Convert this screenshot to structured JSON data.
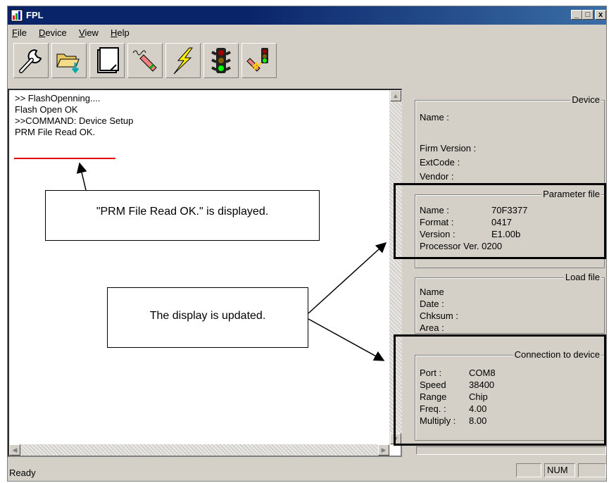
{
  "window": {
    "title": "FPL"
  },
  "menu": [
    {
      "label": "File",
      "accel": "F",
      "rest": "ile"
    },
    {
      "label": "Device",
      "accel": "D",
      "rest": "evice"
    },
    {
      "label": "View",
      "accel": "V",
      "rest": "iew"
    },
    {
      "label": "Help",
      "accel": "H",
      "rest": "elp"
    }
  ],
  "toolbar": {
    "buttons": [
      "wrench-icon",
      "open-folder-icon",
      "blank-page-icon",
      "erase-icon",
      "lightning-icon",
      "traffic-light-icon",
      "autoprocedure-icon"
    ]
  },
  "log": {
    "lines": [
      ">> FlashOpenning....",
      "Flash Open OK",
      ">>COMMAND: Device Setup",
      "PRM File Read OK."
    ]
  },
  "device": {
    "title": "Device",
    "name_label": "Name :",
    "firm_label": "Firm Version :",
    "extcode_label": "ExtCode :",
    "vendor_label": "Vendor :"
  },
  "parameter_file": {
    "title": "Parameter file",
    "name_label": "Name :",
    "name_value": "70F3377",
    "format_label": "Format :",
    "format_value": "0417",
    "version_label": "Version :",
    "version_value": "E1.00b",
    "processor_label": "Processor Ver. 0200"
  },
  "load_file": {
    "title": "Load file",
    "name_label": "Name",
    "date_label": "Date :",
    "chksum_label": "Chksum :",
    "area_label": "Area :"
  },
  "connection": {
    "title": "Connection to device",
    "port_label": "Port :",
    "port_value": "COM8",
    "speed_label": "Speed",
    "speed_value": "38400",
    "range_label": "Range",
    "range_value": "Chip",
    "freq_label": "Freq. :",
    "freq_value": "4.00",
    "multiply_label": "Multiply :",
    "multiply_value": "8.00"
  },
  "status": {
    "text": "Ready",
    "num": "NUM"
  },
  "annotations": {
    "callout1": "\"PRM File Read OK.\" is displayed.",
    "callout2": "The display is updated."
  }
}
